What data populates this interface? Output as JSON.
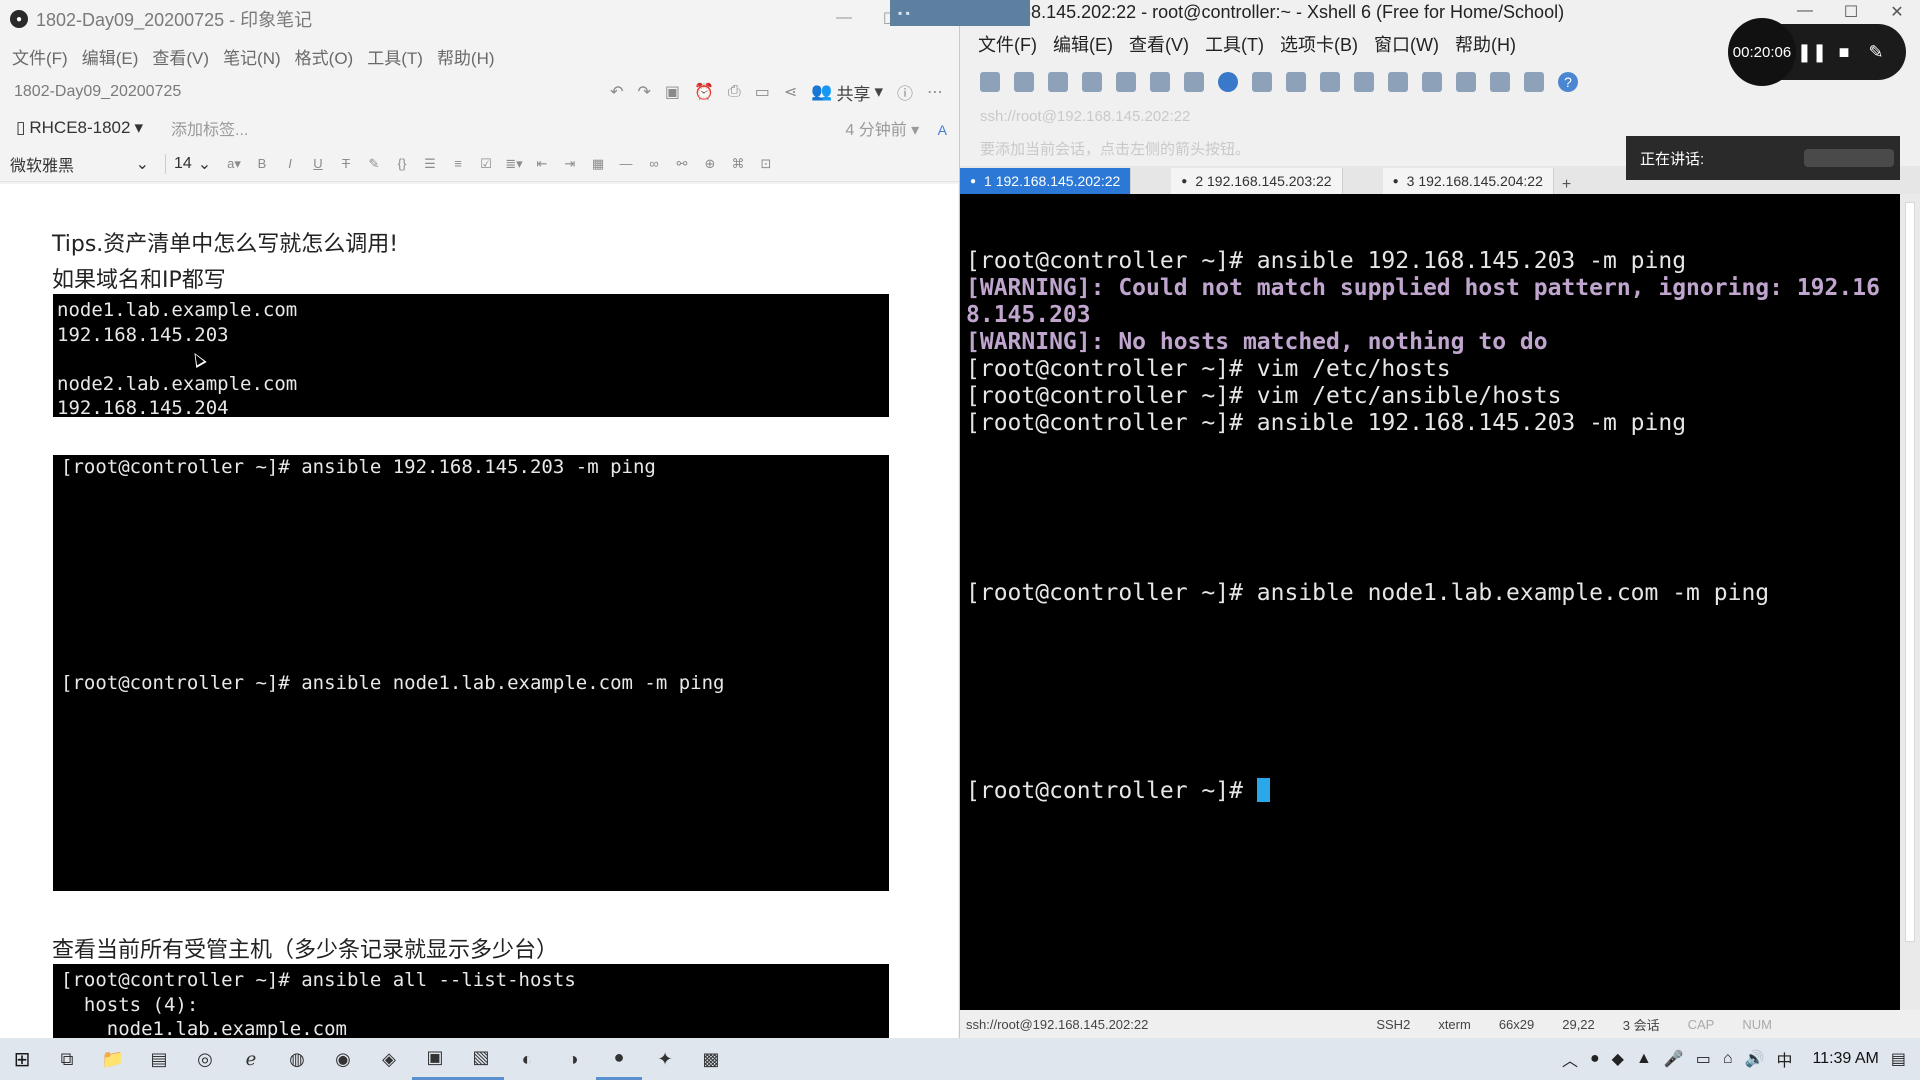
{
  "evernote": {
    "title": "1802-Day09_20200725 - 印象笔记",
    "menu": [
      "文件(F)",
      "编辑(E)",
      "查看(V)",
      "笔记(N)",
      "格式(O)",
      "工具(T)",
      "帮助(H)"
    ],
    "note_title": "1802-Day09_20200725",
    "share_label": "共享",
    "notebook": "RHCE8-1802",
    "add_tag": "添加标签...",
    "time_ago": "4 分钟前",
    "font_name": "微软雅黑",
    "font_size": "14",
    "tips_line1": "Tips.资产清单中怎么写就怎么调用!",
    "tips_line2": "如果域名和IP都写",
    "block1": [
      "node1.lab.example.com",
      "192.168.145.203",
      "",
      "node2.lab.example.com",
      "192.168.145.204"
    ],
    "block2_line1": "[root@controller ~]# ansible 192.168.145.203 -m ping",
    "block2_line2": "[root@controller ~]# ansible node1.lab.example.com -m ping",
    "list_heading": "查看当前所有受管主机（多少条记录就显示多少台）",
    "block3": [
      "[root@controller ~]# ansible all --list-hosts",
      "  hosts (4):",
      "    node1.lab.example.com"
    ]
  },
  "xshell": {
    "title": "192.168.145.202:22 - root@controller:~ - Xshell 6 (Free for Home/School)",
    "menu": [
      "文件(F)",
      "编辑(E)",
      "查看(V)",
      "工具(T)",
      "选项卡(B)",
      "窗口(W)",
      "帮助(H)"
    ],
    "address": "ssh://root@192.168.145.202:22",
    "hint": "要添加当前会话，点击左侧的箭头按钮。",
    "speaking_label": "正在讲话:",
    "tabs": [
      {
        "label": "1 192.168.145.202:22",
        "active": true
      },
      {
        "label": "2 192.168.145.203:22",
        "active": false
      },
      {
        "label": "3 192.168.145.204:22",
        "active": false
      }
    ],
    "terminal": [
      "[root@controller ~]# ansible 192.168.145.203 -m ping",
      "[WARNING]: Could not match supplied host pattern, ignoring: 192.16",
      "8.145.203",
      "[WARNING]: No hosts matched, nothing to do",
      "[root@controller ~]# vim /etc/hosts",
      "[root@controller ~]# vim /etc/ansible/hosts",
      "[root@controller ~]# ansible 192.168.145.203 -m ping",
      "[root@controller ~]# ansible node1.lab.example.com -m ping",
      "[root@controller ~]# "
    ],
    "status": {
      "connection": "ssh://root@192.168.145.202:22",
      "protocol": "SSH2",
      "term": "xterm",
      "size": "66x29",
      "cursor": "29,22",
      "sessions": "3 会话",
      "caps": "CAP",
      "num": "NUM"
    }
  },
  "recorder": {
    "time": "00:20:06"
  },
  "taskbar": {
    "clock": "11:39 AM"
  }
}
